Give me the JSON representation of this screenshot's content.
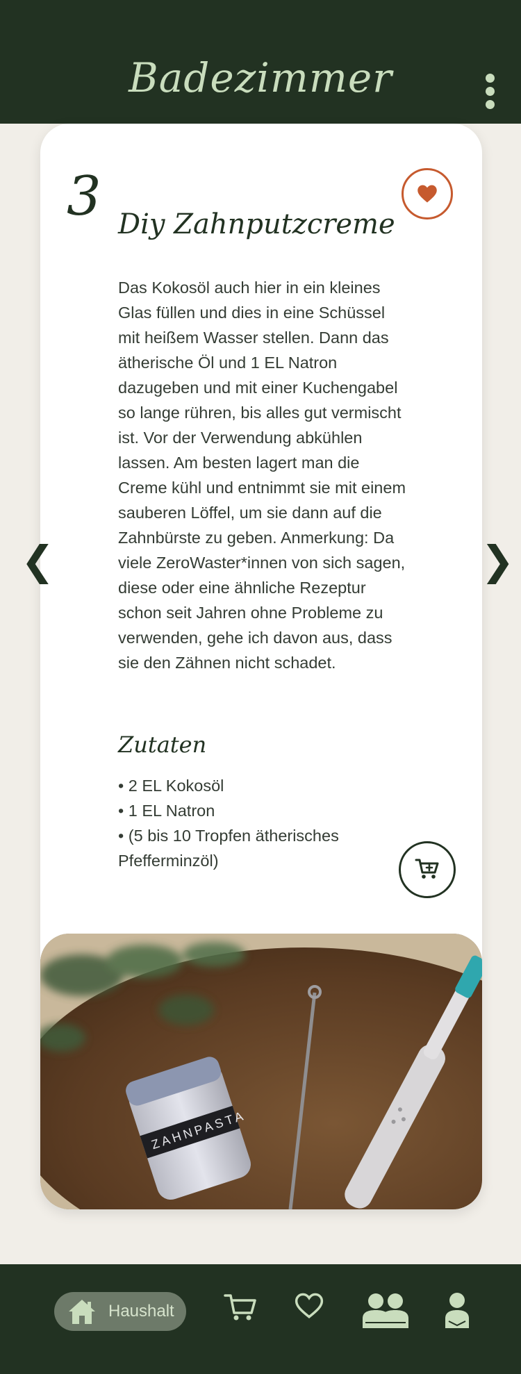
{
  "header": {
    "title": "Badezimmer",
    "menu_icon": "more-vertical-icon"
  },
  "recipe": {
    "step": "3",
    "title": "Diy Zahnputzcreme",
    "favorite_icon": "heart-icon",
    "body": "Das Kokosöl auch hier in ein kleines Glas füllen und dies in eine Schüssel mit heißem Wasser stellen. Dann das ätherische Öl und 1 EL Natron dazugeben und mit einer Kuchengabel so lange rühren, bis alles gut vermischt ist. Vor der Verwendung abkühlen lassen. Am besten lagert man die Creme kühl und entnimmt sie mit einem sauberen Löffel, um sie dann auf die Zahnbürste zu geben. Anmerkung: Da viele ZeroWaster*innen von sich sagen, diese oder eine ähnliche Rezeptur schon seit Jahren ohne Probleme zu verwenden, gehe ich davon aus, dass sie den Zähnen nicht schadet.",
    "ingredients_title": "Zutaten",
    "ingredients": [
      "2 EL Kokosöl",
      "1 EL Natron",
      "(5 bis 10 Tropfen ätherisches Pfefferminzöl)"
    ],
    "add_to_cart_icon": "cart-plus-icon",
    "photo_label": "ZAHNPASTA"
  },
  "pager": {
    "prev_icon": "chevron-left-icon",
    "next_icon": "chevron-right-icon",
    "prev_glyph": "❮",
    "next_glyph": "❯"
  },
  "bottom_nav": {
    "items": [
      {
        "label": "Haushalt",
        "icon": "house-icon",
        "active": true
      },
      {
        "label": "",
        "icon": "cart-icon",
        "active": false
      },
      {
        "label": "",
        "icon": "heart-icon",
        "active": false
      },
      {
        "label": "",
        "icon": "community-icon",
        "active": false
      },
      {
        "label": "",
        "icon": "profile-icon",
        "active": false
      }
    ]
  },
  "colors": {
    "header_bg": "#223222",
    "page_bg": "#F1EEE8",
    "accent": "#C65A2E",
    "nav_icon": "#C9DDBD"
  }
}
